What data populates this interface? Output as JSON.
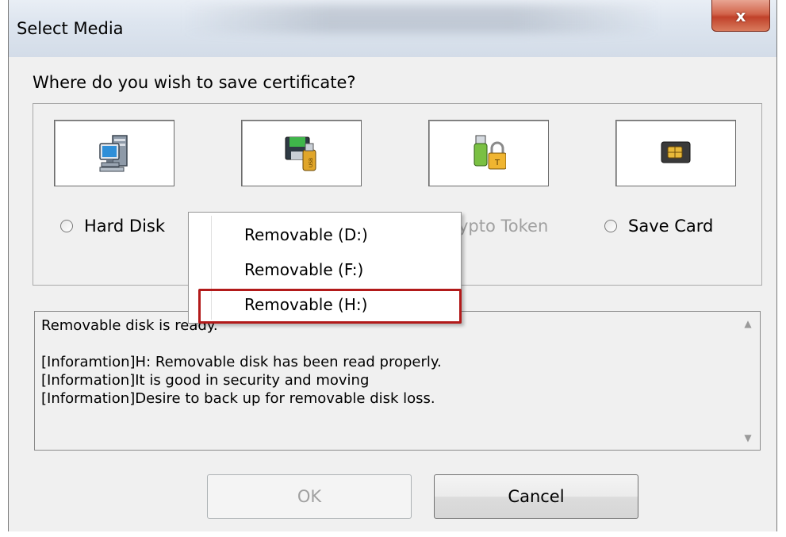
{
  "window": {
    "title": "Select Media",
    "close_label": "x"
  },
  "prompt": "Where do you wish to save certificate?",
  "media_options": [
    {
      "label": "Hard Disk",
      "icon": "computer-icon"
    },
    {
      "label": "",
      "icon": "removable-disk-icon"
    },
    {
      "label": "ypto Token",
      "icon": "crypto-token-icon"
    },
    {
      "label": "Save Card",
      "icon": "smart-card-icon"
    }
  ],
  "dropdown": {
    "items": [
      "Removable (D:)",
      "Removable (F:)",
      "Removable (H:)"
    ],
    "selected": "Removable (H:)"
  },
  "log": {
    "lines": [
      "Removable disk is ready.",
      "",
      "[Inforamtion]H: Removable disk has been read properly.",
      "[Information]It is good in security and moving",
      "[Information]Desire to back up for removable disk loss."
    ]
  },
  "buttons": {
    "ok": "OK",
    "cancel": "Cancel"
  },
  "colors": {
    "highlight": "#b21a1a",
    "dialog_bg": "#f0f0f0"
  }
}
